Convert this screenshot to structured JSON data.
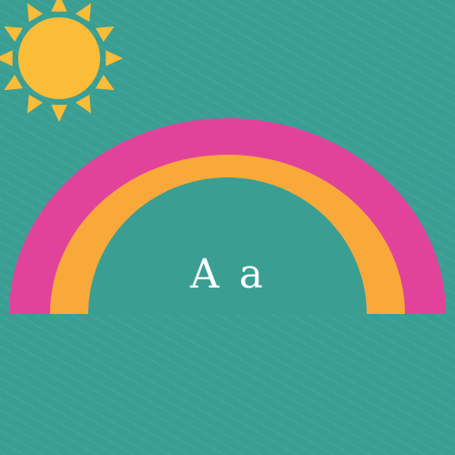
{
  "caption": "A a",
  "illustration": {
    "background_color": "#3a9e93",
    "stripe_color": "#46aca1",
    "sun": {
      "name": "sun-icon",
      "color": "#fbbc37",
      "ray_count": 12
    },
    "rainbow": {
      "name": "rainbow-icon",
      "bands": [
        "#e2439a",
        "#f9a939",
        "#3a9e93"
      ]
    }
  }
}
